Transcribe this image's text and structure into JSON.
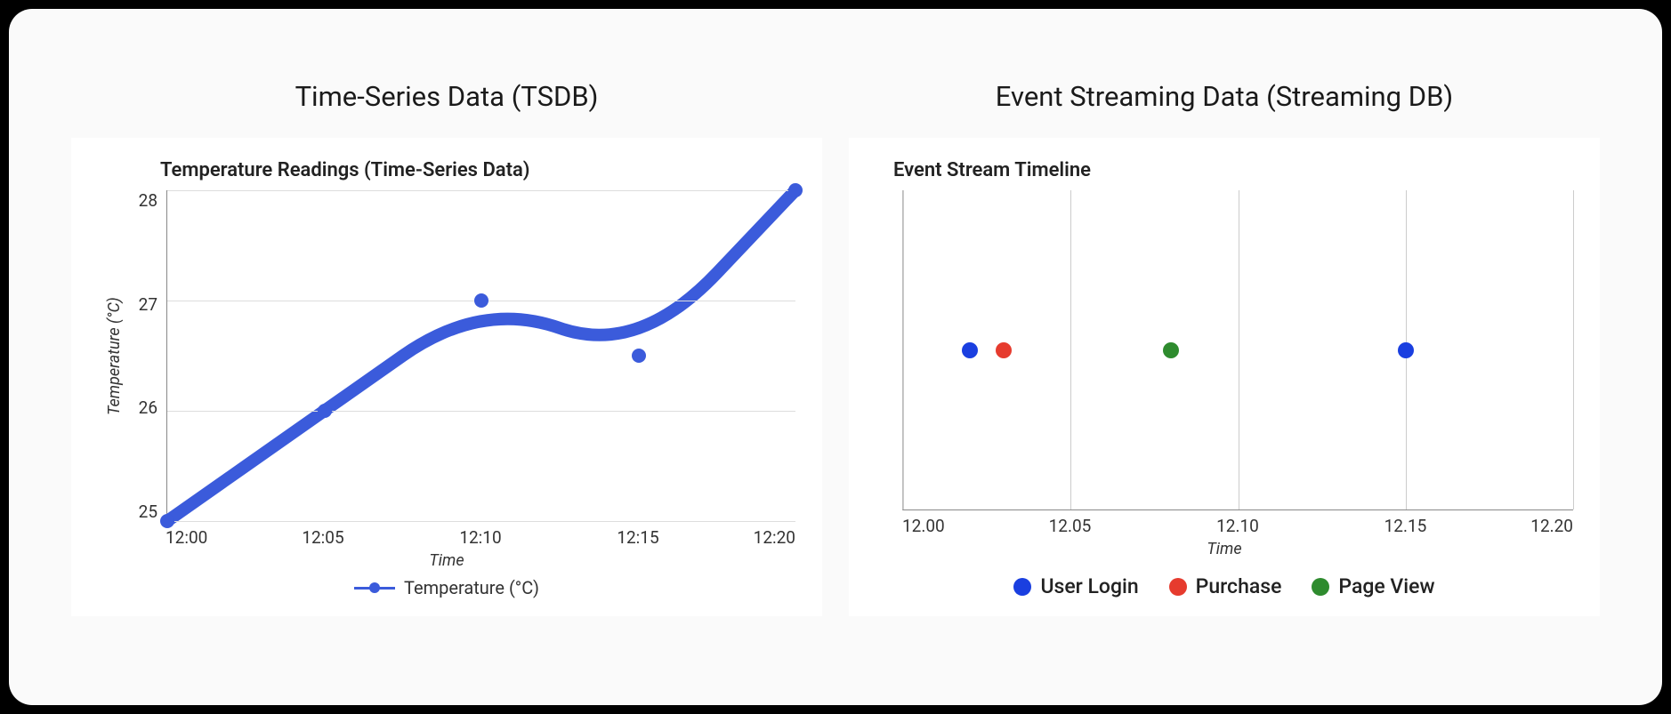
{
  "left": {
    "panel_title": "Time-Series Data (TSDB)",
    "chart_title": "Temperature Readings (Time-Series Data)",
    "y_label": "Temperature (°C)",
    "x_label": "Time",
    "y_ticks": [
      "28",
      "27",
      "26",
      "25"
    ],
    "x_ticks": [
      "12:00",
      "12:05",
      "12:10",
      "12:15",
      "12:20"
    ],
    "legend_label": "Temperature (°C)"
  },
  "right": {
    "panel_title": "Event Streaming Data (Streaming DB)",
    "chart_title": "Event Stream Timeline",
    "x_label": "Time",
    "x_ticks": [
      "12.00",
      "12.05",
      "12.10",
      "12.15",
      "12.20"
    ],
    "legend": [
      {
        "label": "User Login",
        "color": "#1a3fe0"
      },
      {
        "label": "Purchase",
        "color": "#e63b2e"
      },
      {
        "label": "Page View",
        "color": "#2e8b2e"
      }
    ]
  },
  "chart_data": [
    {
      "type": "line",
      "title": "Temperature Readings (Time-Series Data)",
      "xlabel": "Time",
      "ylabel": "Temperature (°C)",
      "ylim": [
        25,
        28
      ],
      "categories": [
        "12:00",
        "12:05",
        "12:10",
        "12:15",
        "12:20"
      ],
      "series": [
        {
          "name": "Temperature (°C)",
          "values": [
            25,
            26,
            27,
            26.5,
            28
          ],
          "color": "#3b5bdb"
        }
      ]
    },
    {
      "type": "scatter",
      "title": "Event Stream Timeline",
      "xlabel": "Time",
      "ylabel": "",
      "xlim": [
        12.0,
        12.2
      ],
      "x_ticks": [
        12.0,
        12.05,
        12.1,
        12.15,
        12.2
      ],
      "legend_position": "bottom",
      "series": [
        {
          "name": "User Login",
          "color": "#1a3fe0",
          "x": [
            12.02,
            12.15
          ],
          "y": [
            0,
            0
          ]
        },
        {
          "name": "Purchase",
          "color": "#e63b2e",
          "x": [
            12.03
          ],
          "y": [
            0
          ]
        },
        {
          "name": "Page View",
          "color": "#2e8b2e",
          "x": [
            12.08
          ],
          "y": [
            0
          ]
        }
      ]
    }
  ]
}
